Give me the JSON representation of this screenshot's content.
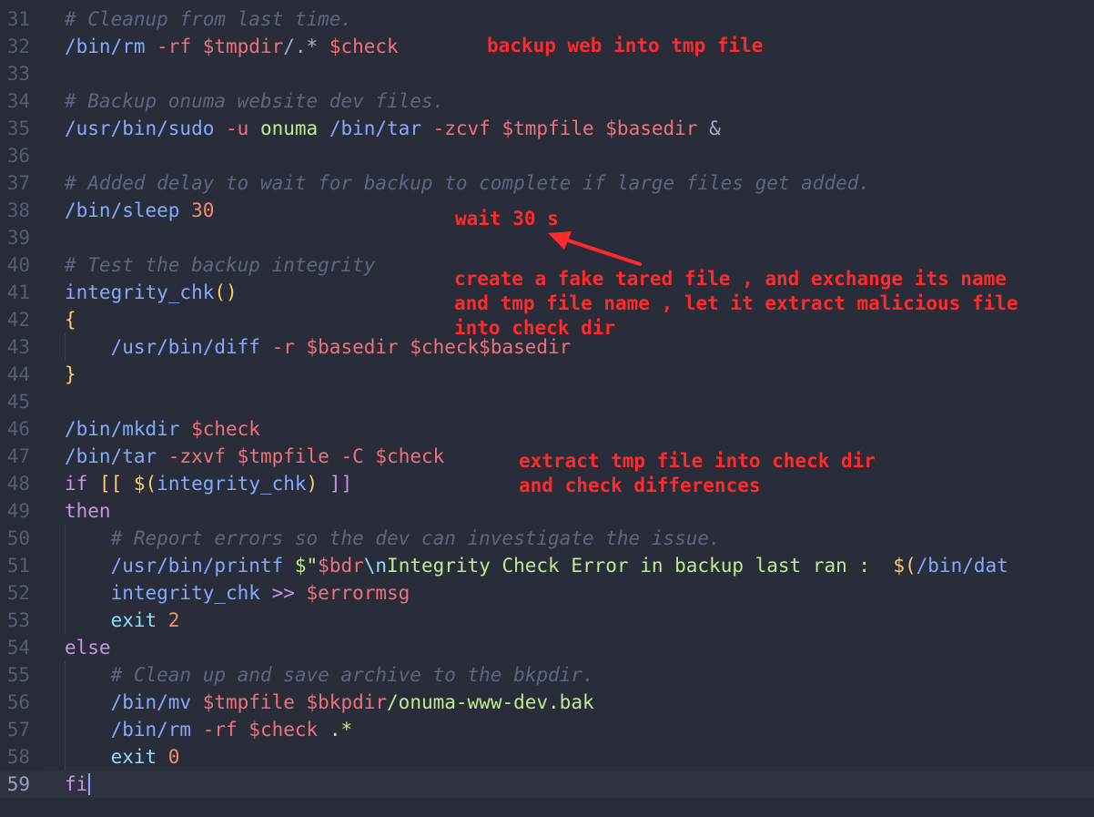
{
  "editor": {
    "current_line": 59,
    "lines": [
      {
        "n": "31",
        "tokens": [
          {
            "t": "# Cleanup from last time.",
            "c": "cmt"
          }
        ]
      },
      {
        "n": "32",
        "tokens": [
          {
            "t": "/bin/rm",
            "c": "cmd"
          },
          {
            "t": " -rf ",
            "c": "flg"
          },
          {
            "t": "$tmpdir",
            "c": "var"
          },
          {
            "t": "/.* ",
            "c": "txt"
          },
          {
            "t": "$check",
            "c": "var"
          }
        ]
      },
      {
        "n": "33",
        "tokens": []
      },
      {
        "n": "34",
        "tokens": [
          {
            "t": "# Backup onuma website dev files.",
            "c": "cmt"
          }
        ]
      },
      {
        "n": "35",
        "tokens": [
          {
            "t": "/usr/bin/sudo",
            "c": "cmd"
          },
          {
            "t": " -u ",
            "c": "flg"
          },
          {
            "t": "onuma ",
            "c": "str"
          },
          {
            "t": "/bin/tar",
            "c": "cmd"
          },
          {
            "t": " -zcvf ",
            "c": "flg"
          },
          {
            "t": "$tmpfile ",
            "c": "var"
          },
          {
            "t": "$basedir ",
            "c": "var"
          },
          {
            "t": "&",
            "c": "txt"
          }
        ]
      },
      {
        "n": "36",
        "tokens": []
      },
      {
        "n": "37",
        "tokens": [
          {
            "t": "# Added delay to wait for backup to complete if large files get added.",
            "c": "cmt"
          }
        ]
      },
      {
        "n": "38",
        "tokens": [
          {
            "t": "/bin/sleep ",
            "c": "cmd"
          },
          {
            "t": "30",
            "c": "num"
          }
        ]
      },
      {
        "n": "39",
        "tokens": []
      },
      {
        "n": "40",
        "tokens": [
          {
            "t": "# Test the backup integrity",
            "c": "cmt"
          }
        ]
      },
      {
        "n": "41",
        "tokens": [
          {
            "t": "integrity_chk",
            "c": "fn"
          },
          {
            "t": "()",
            "c": "br"
          }
        ]
      },
      {
        "n": "42",
        "tokens": [
          {
            "t": "{",
            "c": "br"
          }
        ]
      },
      {
        "n": "43",
        "tokens": [
          {
            "t": "    /usr/bin/diff",
            "c": "cmd"
          },
          {
            "t": " -r ",
            "c": "flg"
          },
          {
            "t": "$basedir ",
            "c": "var"
          },
          {
            "t": "$check",
            "c": "var"
          },
          {
            "t": "$basedir",
            "c": "var"
          }
        ]
      },
      {
        "n": "44",
        "tokens": [
          {
            "t": "}",
            "c": "br"
          }
        ]
      },
      {
        "n": "45",
        "tokens": []
      },
      {
        "n": "46",
        "tokens": [
          {
            "t": "/bin/mkdir ",
            "c": "cmd"
          },
          {
            "t": "$check",
            "c": "var"
          }
        ]
      },
      {
        "n": "47",
        "tokens": [
          {
            "t": "/bin/tar",
            "c": "cmd"
          },
          {
            "t": " -zxvf ",
            "c": "flg"
          },
          {
            "t": "$tmpfile",
            "c": "var"
          },
          {
            "t": " -C ",
            "c": "flg"
          },
          {
            "t": "$check",
            "c": "var"
          }
        ]
      },
      {
        "n": "48",
        "tokens": [
          {
            "t": "if ",
            "c": "kw"
          },
          {
            "t": "[[ ",
            "c": "br"
          },
          {
            "t": "$(",
            "c": "br"
          },
          {
            "t": "integrity_chk",
            "c": "fn"
          },
          {
            "t": ") ",
            "c": "br"
          },
          {
            "t": "]]",
            "c": "kw"
          }
        ]
      },
      {
        "n": "49",
        "tokens": [
          {
            "t": "then",
            "c": "kw"
          }
        ]
      },
      {
        "n": "50",
        "tokens": [
          {
            "t": "    # Report errors so the dev can investigate the issue.",
            "c": "cmt"
          }
        ]
      },
      {
        "n": "51",
        "tokens": [
          {
            "t": "    /usr/bin/printf ",
            "c": "cmd"
          },
          {
            "t": "$\"",
            "c": "str"
          },
          {
            "t": "$bdr",
            "c": "var"
          },
          {
            "t": "\\n",
            "c": "esc"
          },
          {
            "t": "Integrity Check Error in backup last ran :  ",
            "c": "str"
          },
          {
            "t": "$(",
            "c": "br"
          },
          {
            "t": "/bin/dat",
            "c": "cmd"
          }
        ]
      },
      {
        "n": "52",
        "tokens": [
          {
            "t": "    integrity_chk ",
            "c": "fn"
          },
          {
            "t": ">> ",
            "c": "op"
          },
          {
            "t": "$errormsg",
            "c": "var"
          }
        ]
      },
      {
        "n": "53",
        "tokens": [
          {
            "t": "    exit ",
            "c": "esc"
          },
          {
            "t": "2",
            "c": "num"
          }
        ]
      },
      {
        "n": "54",
        "tokens": [
          {
            "t": "else",
            "c": "kw"
          }
        ]
      },
      {
        "n": "55",
        "tokens": [
          {
            "t": "    # Clean up and save archive to the bkpdir.",
            "c": "cmt"
          }
        ]
      },
      {
        "n": "56",
        "tokens": [
          {
            "t": "    /bin/mv ",
            "c": "cmd"
          },
          {
            "t": "$tmpfile ",
            "c": "var"
          },
          {
            "t": "$bkpdir",
            "c": "var"
          },
          {
            "t": "/onuma-www-dev.bak",
            "c": "str"
          }
        ]
      },
      {
        "n": "57",
        "tokens": [
          {
            "t": "    /bin/rm",
            "c": "cmd"
          },
          {
            "t": " -rf ",
            "c": "flg"
          },
          {
            "t": "$check ",
            "c": "var"
          },
          {
            "t": ".*",
            "c": "str"
          }
        ]
      },
      {
        "n": "58",
        "tokens": [
          {
            "t": "    exit ",
            "c": "esc"
          },
          {
            "t": "0",
            "c": "num"
          }
        ]
      },
      {
        "n": "59",
        "tokens": [
          {
            "t": "fi",
            "c": "kw"
          }
        ]
      }
    ]
  },
  "annotations": {
    "backup_note": "backup web into tmp file",
    "wait_note": "wait 30 s",
    "fake_tar_note": "create a fake tared file , and exchange its name\nand tmp file name , let it extract malicious file\ninto check dir",
    "extract_note": "extract tmp file into check dir\nand check differences",
    "color": "#ff2a2a"
  }
}
